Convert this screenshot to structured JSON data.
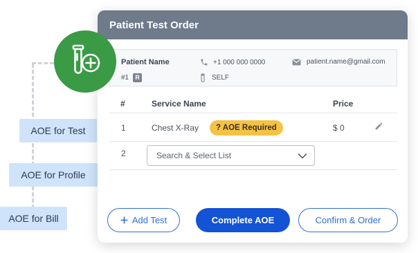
{
  "side_tags": [
    {
      "label": "AOE for Test"
    },
    {
      "label": "AOE for Profile"
    },
    {
      "label": "AOE for Bill"
    }
  ],
  "card": {
    "title": "Patient Test Order",
    "patient": {
      "name_label": "Patient Name",
      "id": "#1",
      "id_badge": "R",
      "phone": "+1 000 000 0000",
      "relation": "SELF",
      "email": "patient.name@gmail.com"
    },
    "table": {
      "headers": {
        "num": "#",
        "service": "Service Name",
        "price": "Price"
      },
      "rows": [
        {
          "num": "1",
          "service": "Chest X-Ray",
          "badge": "? AOE Required",
          "price": "$  0"
        },
        {
          "num": "2",
          "select_placeholder": "Search & Select List"
        }
      ]
    },
    "buttons": {
      "add_test": "Add Test",
      "complete_aoe": "Complete AOE",
      "confirm_order": "Confirm & Order"
    }
  },
  "colors": {
    "header": "#6f7a8a",
    "primary": "#1353d6",
    "badge_yellow": "#f6c244",
    "icon_green": "#3a9a45",
    "tag_blue": "#cfe3fb"
  }
}
